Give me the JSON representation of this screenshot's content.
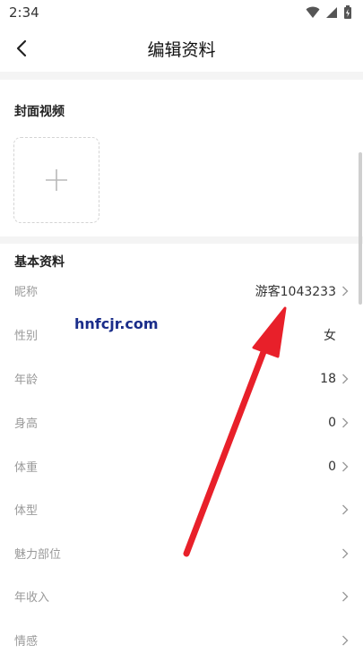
{
  "status": {
    "time": "2:34"
  },
  "nav": {
    "title": "编辑资料"
  },
  "cover": {
    "title": "封面视频"
  },
  "basic": {
    "title": "基本资料",
    "rows": [
      {
        "label": "昵称",
        "value": "游客1043233",
        "chevron": true
      },
      {
        "label": "性别",
        "value": "女",
        "chevron": false
      },
      {
        "label": "年龄",
        "value": "18",
        "chevron": true
      },
      {
        "label": "身高",
        "value": "0",
        "chevron": true
      },
      {
        "label": "体重",
        "value": "0",
        "chevron": true
      },
      {
        "label": "体型",
        "value": "",
        "chevron": true
      },
      {
        "label": "魅力部位",
        "value": "",
        "chevron": true
      },
      {
        "label": "年收入",
        "value": "",
        "chevron": true
      },
      {
        "label": "情感",
        "value": "",
        "chevron": true
      }
    ]
  },
  "watermark": {
    "text": "hnfcjr.com"
  },
  "colors": {
    "annotation_arrow": "#e8202a",
    "watermark": "#1a2d8a"
  }
}
